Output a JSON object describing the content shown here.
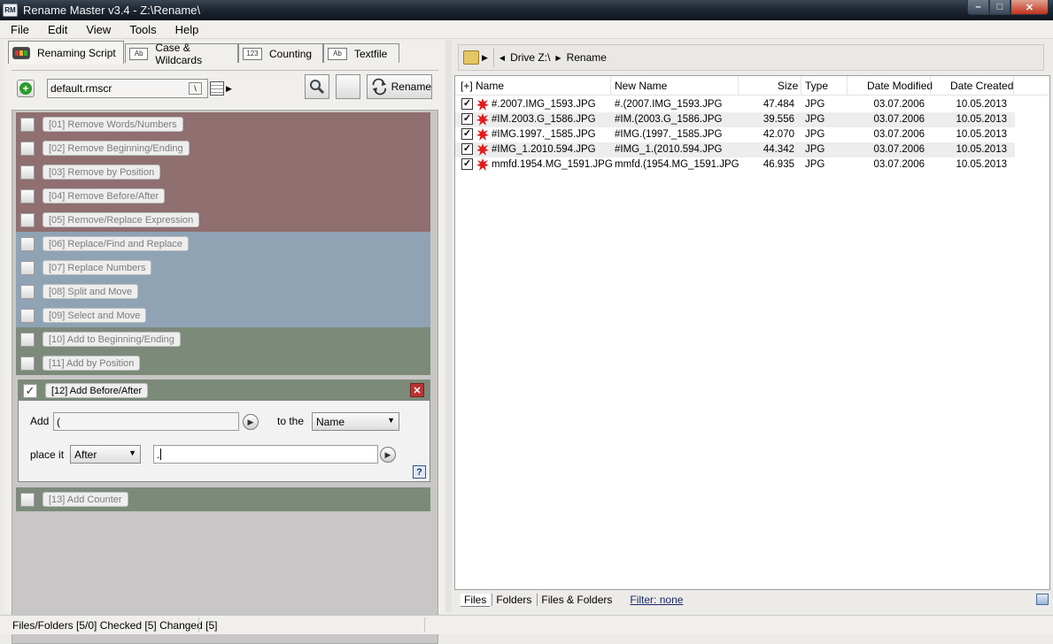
{
  "window": {
    "app_abbr": "RM",
    "title": "Rename Master v3.4 - Z:\\Rename\\"
  },
  "menu": [
    "File",
    "Edit",
    "View",
    "Tools",
    "Help"
  ],
  "left_tabs": [
    "Renaming Script",
    "Case & Wildcards",
    "Counting",
    "Textfile"
  ],
  "toolbar": {
    "script_file": "default.rmscr",
    "slash_glyph": "\\",
    "rename_label": "Rename"
  },
  "rules": [
    {
      "label": "[01]  Remove Words/Numbers",
      "group": 1
    },
    {
      "label": "[02]  Remove Beginning/Ending",
      "group": 1
    },
    {
      "label": "[03]  Remove by Position",
      "group": 1
    },
    {
      "label": "[04]  Remove Before/After",
      "group": 1
    },
    {
      "label": "[05]  Remove/Replace Expression",
      "group": 1
    },
    {
      "label": "[06]  Replace/Find and Replace",
      "group": 2
    },
    {
      "label": "[07]  Replace Numbers",
      "group": 2
    },
    {
      "label": "[08]  Split and Move",
      "group": 2
    },
    {
      "label": "[09]  Select and Move",
      "group": 2
    },
    {
      "label": "[10]  Add to Beginning/Ending",
      "group": 3
    },
    {
      "label": "[11]  Add by Position",
      "group": 3
    }
  ],
  "expanded_rule": {
    "label": "[12]  Add Before/After",
    "add_label": "Add",
    "add_value": "(",
    "to_the_label": "to the",
    "to_the_value": "Name",
    "place_label": "place it",
    "place_value": "After",
    "place_text": ".",
    "help": "?"
  },
  "rule13": {
    "label": "[13]  Add Counter"
  },
  "address": {
    "drive": "Drive Z:\\",
    "folder": "Rename"
  },
  "file_columns": {
    "name": "[+] Name",
    "new_name": "New Name",
    "size": "Size",
    "type": "Type",
    "modified": "Date Modified",
    "created": "Date Created"
  },
  "files": [
    {
      "name": "#.2007.IMG_1593.JPG",
      "new_name": "#.(2007.IMG_1593.JPG",
      "size": "47.484",
      "type": "JPG",
      "modified": "03.07.2006",
      "created": "10.05.2013",
      "checked": true
    },
    {
      "name": "#IM.2003.G_1586.JPG",
      "new_name": "#IM.(2003.G_1586.JPG",
      "size": "39.556",
      "type": "JPG",
      "modified": "03.07.2006",
      "created": "10.05.2013",
      "checked": true
    },
    {
      "name": "#IMG.1997._1585.JPG",
      "new_name": "#IMG.(1997._1585.JPG",
      "size": "42.070",
      "type": "JPG",
      "modified": "03.07.2006",
      "created": "10.05.2013",
      "checked": true
    },
    {
      "name": "#IMG_1.2010.594.JPG",
      "new_name": "#IMG_1.(2010.594.JPG",
      "size": "44.342",
      "type": "JPG",
      "modified": "03.07.2006",
      "created": "10.05.2013",
      "checked": true
    },
    {
      "name": "mmfd.1954.MG_1591.JPG",
      "new_name": "mmfd.(1954.MG_1591.JPG",
      "size": "46.935",
      "type": "JPG",
      "modified": "03.07.2006",
      "created": "10.05.2013",
      "checked": true
    }
  ],
  "bottom_tabs": [
    "Files",
    "Folders",
    "Files & Folders"
  ],
  "filter": "Filter:  none",
  "status": "Files/Folders [5/0] Checked [5] Changed [5]"
}
